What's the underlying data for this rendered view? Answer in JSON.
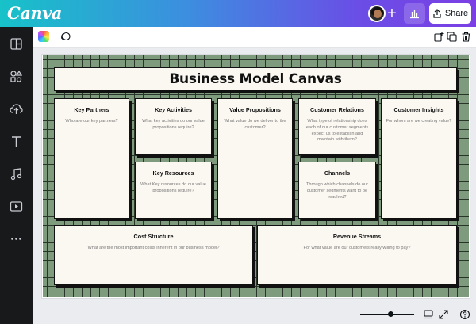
{
  "app": {
    "logo_text": "Canva",
    "share_label": "Share",
    "colors": {
      "header_start": "#17c2c8",
      "header_end": "#7b3fe4",
      "sidebar": "#18191b",
      "board_green": "#7f9b7e",
      "card_bg": "#fbf7f1"
    }
  },
  "header": {
    "avatar": "user-avatar",
    "add_icon": "plus-icon",
    "analytics_icon": "bar-chart-icon",
    "share_icon": "share-upload-icon"
  },
  "sidebar": {
    "items": [
      {
        "icon": "layout-icon"
      },
      {
        "icon": "elements-icon"
      },
      {
        "icon": "upload-cloud-icon"
      },
      {
        "icon": "text-icon"
      },
      {
        "icon": "music-icon"
      },
      {
        "icon": "video-icon"
      },
      {
        "icon": "more-icon"
      }
    ]
  },
  "toolbar": {
    "left": [
      "color-palette-icon",
      "animate-icon"
    ],
    "right": [
      "add-page-icon",
      "duplicate-icon",
      "trash-icon"
    ]
  },
  "canvas": {
    "title": "Business Model Canvas",
    "sections": {
      "key_partners": {
        "title": "Key Partners",
        "desc": "Who are our key partners?"
      },
      "key_activities": {
        "title": "Key Activities",
        "desc": "What key activities do our value propositions require?"
      },
      "value_propositions": {
        "title": "Value Propositions",
        "desc": "What value do we deliver to the customer?"
      },
      "customer_relations": {
        "title": "Customer Relations",
        "desc": "What type of relationship does each of our customer segments expect us to establish and maintain with them?"
      },
      "customer_insights": {
        "title": "Customer Insights",
        "desc": "For whom are we creating value?"
      },
      "key_resources": {
        "title": "Key Resources",
        "desc": "What Key resources do our value propositions require?"
      },
      "channels": {
        "title": "Channels",
        "desc": "Through which channels do our customer segments want to be reached?"
      },
      "cost_structure": {
        "title": "Cost Structure",
        "desc": "What are the most important costs inherent in our business model?"
      },
      "revenue_streams": {
        "title": "Revenue Streams",
        "desc": "For what value are our customers really willing to pay?"
      }
    }
  },
  "bottombar": {
    "zoom_level": 0.5,
    "icons": [
      "pages-icon",
      "fullscreen-icon",
      "help-icon"
    ]
  }
}
